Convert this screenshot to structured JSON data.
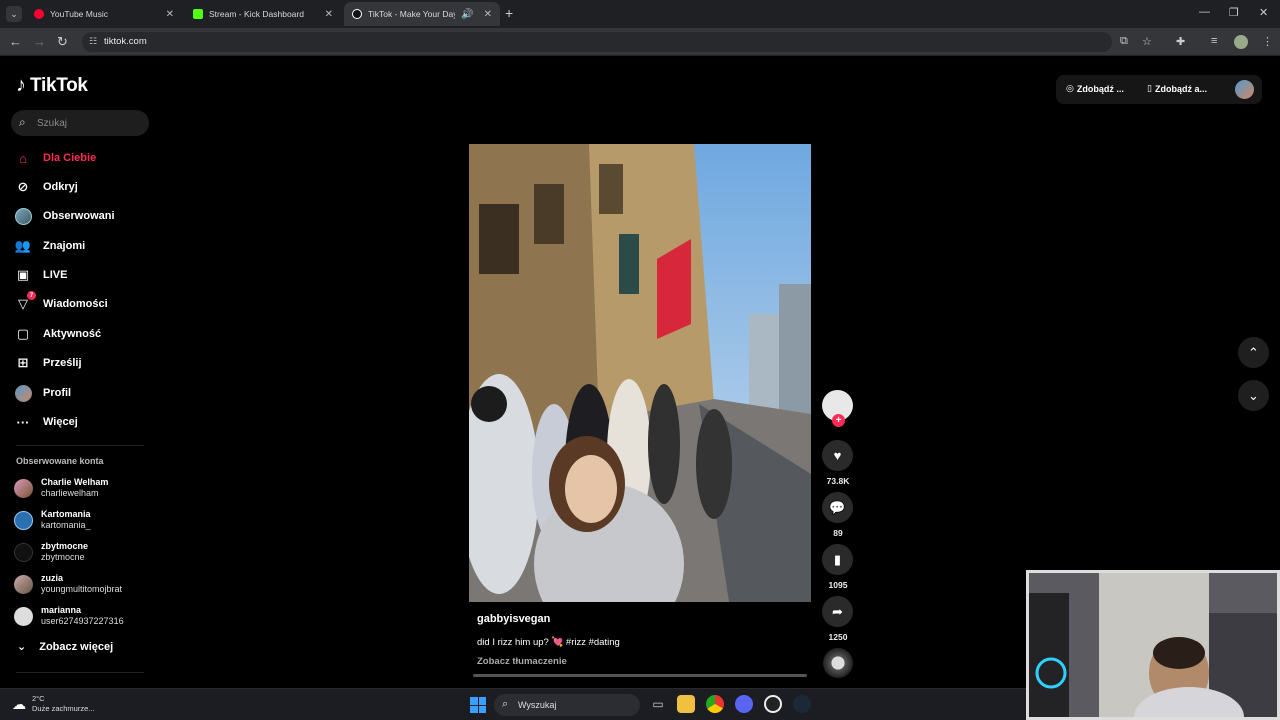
{
  "browser": {
    "tabs": [
      {
        "title": "YouTube Music",
        "active": false,
        "favicon_color": "#ff0033"
      },
      {
        "title": "Stream - Kick Dashboard",
        "active": false,
        "favicon_color": "#53fc18"
      },
      {
        "title": "TikTok - Make Your Day",
        "active": true,
        "favicon_color": "#ffffff"
      }
    ],
    "url": "tiktok.com"
  },
  "sidebar": {
    "logo": "TikTok",
    "search_placeholder": "Szukaj",
    "nav": [
      {
        "label": "Dla Ciebie",
        "icon": "home-icon",
        "active": true
      },
      {
        "label": "Odkryj",
        "icon": "compass-icon"
      },
      {
        "label": "Obserwowani",
        "icon": "avatar-icon"
      },
      {
        "label": "Znajomi",
        "icon": "friends-icon"
      },
      {
        "label": "LIVE",
        "icon": "live-icon"
      },
      {
        "label": "Wiadomości",
        "icon": "messages-icon",
        "badge": "7"
      },
      {
        "label": "Aktywność",
        "icon": "activity-icon"
      },
      {
        "label": "Prześlij",
        "icon": "upload-icon"
      },
      {
        "label": "Profil",
        "icon": "profile-icon"
      },
      {
        "label": "Więcej",
        "icon": "more-icon"
      }
    ],
    "followed_title": "Obserwowane konta",
    "followed": [
      {
        "name": "Charlie Welham",
        "handle": "charliewelham"
      },
      {
        "name": "Kartomania",
        "handle": "kartomania_"
      },
      {
        "name": "zbytmocne",
        "handle": "zbytmocne"
      },
      {
        "name": "zuzia",
        "handle": "youngmultitomojbrat"
      },
      {
        "name": "marianna",
        "handle": "user6274937227316"
      }
    ],
    "see_more": "Zobacz więcej"
  },
  "topbar": {
    "btn1": "Zdobądź ...",
    "btn2": "Zdobądź a..."
  },
  "video": {
    "username": "gabbyisvegan",
    "caption": "did I rizz him up? 💘 #rizz #dating",
    "translate": "Zobacz tłumaczenie",
    "likes": "73.8K",
    "comments": "89",
    "saves": "1095",
    "shares": "1250"
  },
  "taskbar": {
    "temp": "2°C",
    "weather": "Duże zachmurze...",
    "search": "Wyszukaj"
  }
}
